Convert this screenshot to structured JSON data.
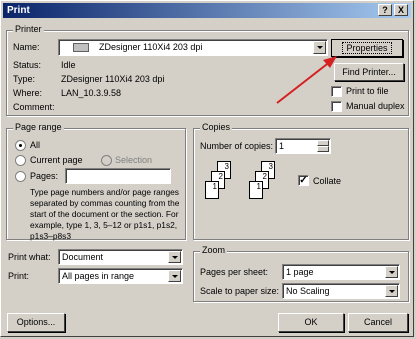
{
  "window": {
    "title": "Print",
    "help_button": "?",
    "close_button": "X"
  },
  "printer": {
    "group_label": "Printer",
    "name_label": "Name:",
    "name_value": "ZDesigner 110Xi4 203 dpi",
    "status_label": "Status:",
    "status_value": "Idle",
    "type_label": "Type:",
    "type_value": "ZDesigner 110Xi4 203 dpi",
    "where_label": "Where:",
    "where_value": "LAN_10.3.9.58",
    "comment_label": "Comment:",
    "comment_value": "",
    "properties_button": "Properties",
    "find_printer_button": "Find Printer...",
    "print_to_file_label": "Print to file",
    "manual_duplex_label": "Manual duplex"
  },
  "page_range": {
    "group_label": "Page range",
    "all_label": "All",
    "current_page_label": "Current page",
    "selection_label": "Selection",
    "pages_label": "Pages:",
    "pages_value": "",
    "help_text": "Type page numbers and/or page ranges separated by commas counting from the start of the document or the section. For example, type 1, 3, 5–12 or p1s1, p1s2, p1s3–p8s3"
  },
  "copies": {
    "group_label": "Copies",
    "number_label": "Number of copies:",
    "number_value": "1",
    "collate_label": "Collate"
  },
  "print_what": {
    "label": "Print what:",
    "value": "Document"
  },
  "print": {
    "label": "Print:",
    "value": "All pages in range"
  },
  "zoom": {
    "group_label": "Zoom",
    "pages_per_sheet_label": "Pages per sheet:",
    "pages_per_sheet_value": "1 page",
    "scale_label": "Scale to paper size:",
    "scale_value": "No Scaling"
  },
  "buttons": {
    "options": "Options...",
    "ok": "OK",
    "cancel": "Cancel"
  },
  "colors": {
    "title_bar": "#0a246a",
    "face": "#d4d0c8",
    "arrow": "#d42020"
  }
}
